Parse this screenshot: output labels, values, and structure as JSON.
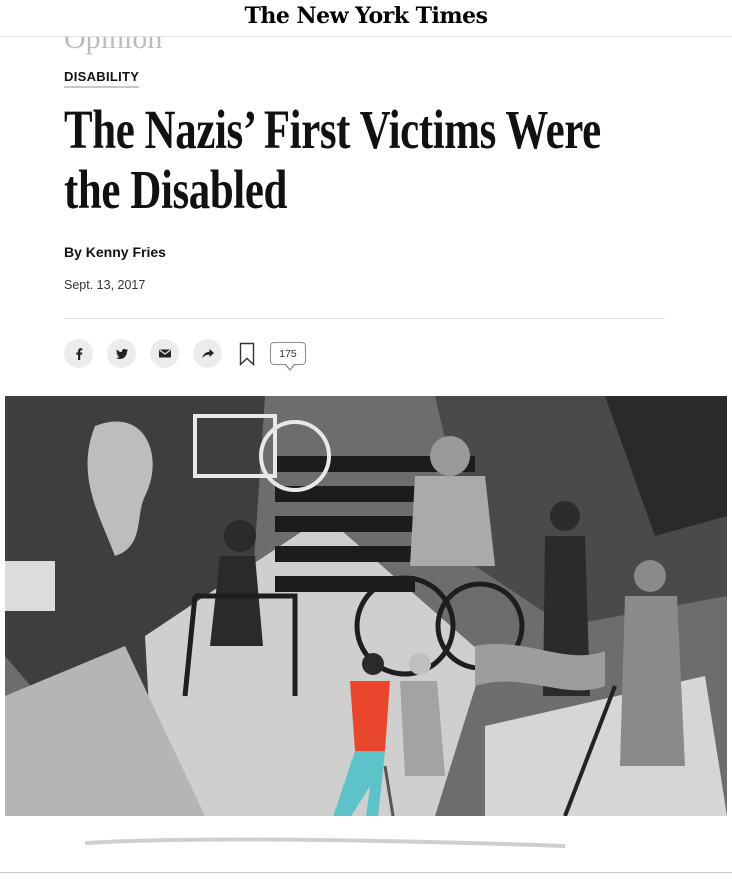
{
  "masthead": {
    "logo_text": "The New York Times"
  },
  "section": {
    "label": "Opinion"
  },
  "article": {
    "kicker": "DISABILITY",
    "headline": "The Nazis’ First Victims Were the Disabled",
    "byline": "By Kenny Fries",
    "date": "Sept. 13, 2017"
  },
  "share": {
    "icons": [
      "facebook-icon",
      "twitter-icon",
      "email-icon",
      "share-icon",
      "bookmark-icon"
    ],
    "comment_count": "175"
  },
  "colors": {
    "accent_red": "#e8472c",
    "accent_teal": "#5cc3c9",
    "text": "#121212",
    "rule": "#e2e2e2"
  }
}
